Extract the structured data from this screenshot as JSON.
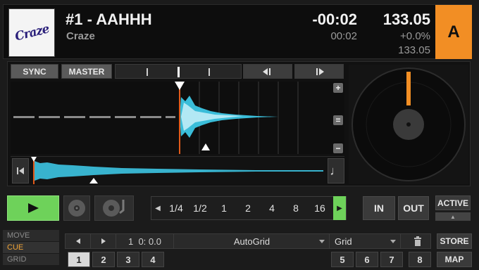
{
  "deck": {
    "cover_text": "Craze",
    "title": "#1 - AAHHH",
    "artist": "Craze",
    "time_remaining": "-00:02",
    "time_elapsed": "00:02",
    "bpm": "133.05",
    "pitch": "+0.0%",
    "bpm_base": "133.05",
    "letter": "A",
    "accent_color": "#f28e24",
    "waveform_color": "#3fd0f0"
  },
  "controls": {
    "sync": "SYNC",
    "master": "MASTER",
    "nudge_back_icon": "nudge-backward-icon",
    "nudge_fwd_icon": "nudge-forward-icon",
    "zoom_in": "+",
    "zoom_reset": "=",
    "zoom_out": "−",
    "flux_glyph": "♩"
  },
  "transport": {
    "play_icon": "play-icon",
    "loop_sizes": [
      "1/4",
      "1/2",
      "1",
      "2",
      "4",
      "8",
      "16"
    ],
    "loop_active_color": "#6ed25a",
    "in": "IN",
    "out": "OUT",
    "active": "ACTIVE"
  },
  "cue": {
    "modes": [
      "MOVE",
      "CUE",
      "GRID"
    ],
    "selected_mode": "CUE",
    "position": "1  0: 0.0",
    "autogrid": "AutoGrid",
    "type": "Grid",
    "store": "STORE",
    "map": "MAP",
    "hotcues": [
      "1",
      "2",
      "3",
      "4",
      "5",
      "6",
      "7",
      "8"
    ],
    "selected_hotcue": "1"
  }
}
